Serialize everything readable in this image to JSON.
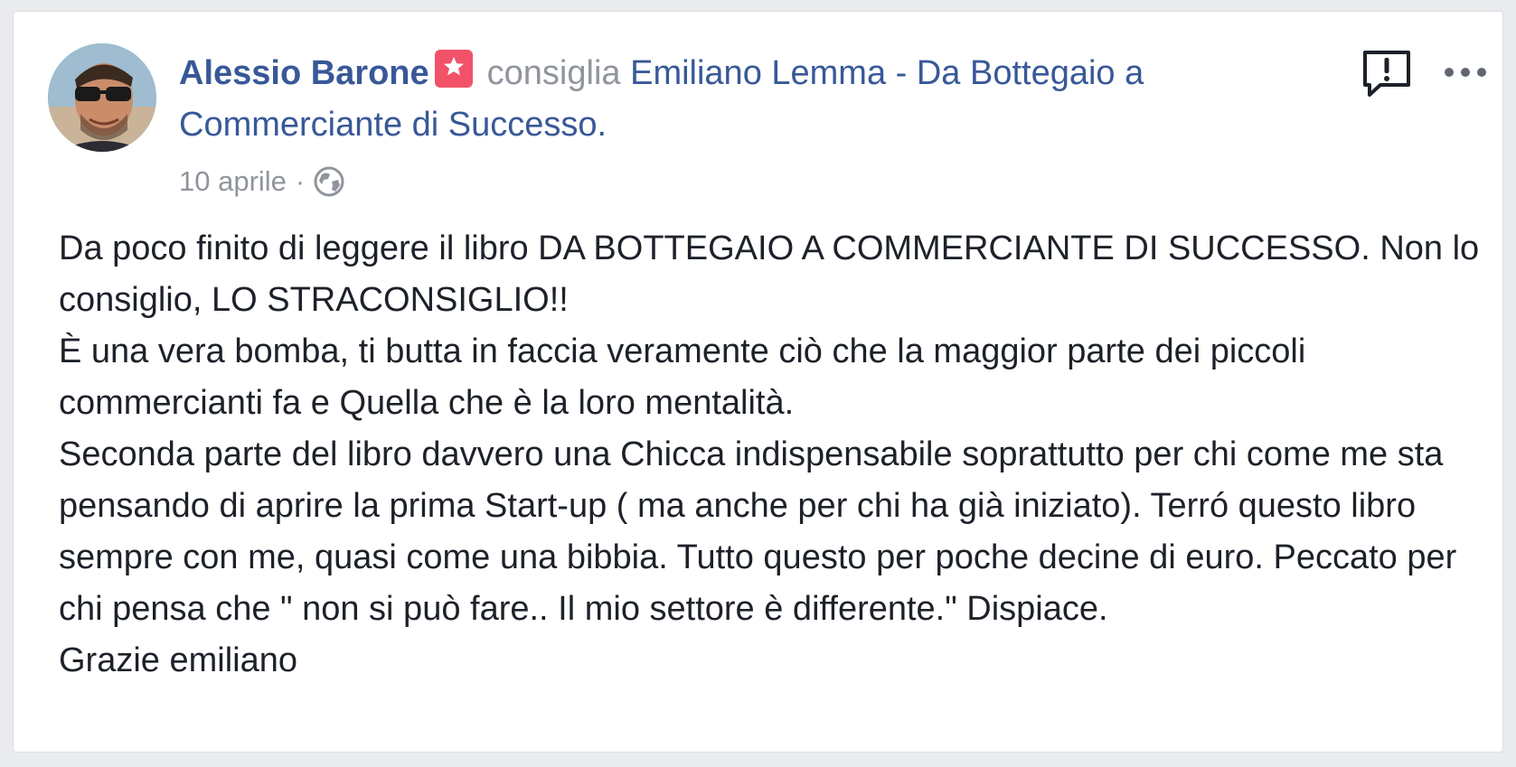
{
  "post": {
    "author": "Alessio Barone",
    "action_text": "consiglia",
    "page_name": "Emiliano Lemma - Da Bottegaio a Commerciante di Successo.",
    "date": "10 aprile",
    "separator": "·",
    "privacy_icon": "globe-icon",
    "recommendation_badge_icon": "star-icon",
    "badge_color": "#f25268",
    "link_color": "#385898",
    "body_lines": [
      "Da poco finito di leggere il libro DA BOTTEGAIO A COMMERCIANTE DI SUCCESSO. Non lo consiglio, LO STRACONSIGLIO!!",
      "È una vera bomba, ti butta in faccia veramente ciò che la maggior parte dei piccoli commercianti fa e Quella che è la loro mentalità.",
      "Seconda parte del libro davvero una Chicca indispensabile soprattutto per chi come me sta pensando di aprire la prima Start-up ( ma anche per chi ha già iniziato). Terró questo libro sempre con me, quasi come una bibbia. Tutto questo per poche decine di euro. Peccato per chi pensa che \" non si può fare.. Il mio settore è differente.\" Dispiace.",
      "Grazie emiliano"
    ]
  },
  "actions": {
    "report_icon": "report-icon",
    "more_icon": "more-options-icon"
  }
}
